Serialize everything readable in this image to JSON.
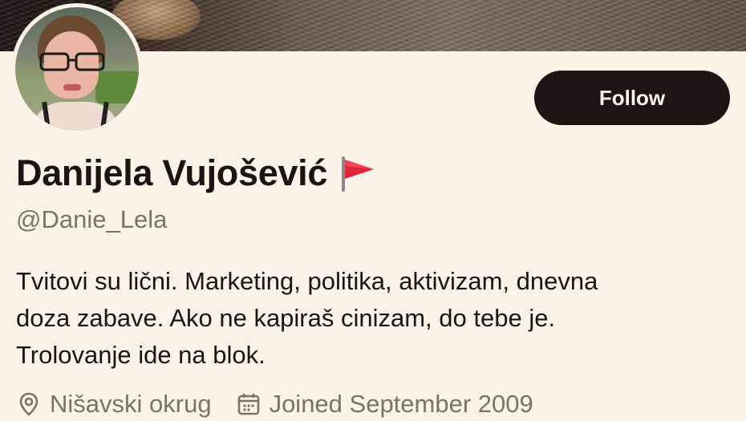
{
  "profile": {
    "display_name": "Danijela Vujošević",
    "name_emoji_icon": "red-flag-icon",
    "handle": "@Danie_Lela",
    "bio_lines": [
      "Tvitovi su lični. Marketing, politika, aktivizam, dnevna",
      "doza zabave. Ako ne kapiraš cinizam, do tebe je.",
      "Trolovanje ide na blok."
    ],
    "location": "Nišavski okrug",
    "joined": "Joined September 2009"
  },
  "actions": {
    "follow_label": "Follow"
  },
  "colors": {
    "background": "#fcf3e8",
    "button_bg": "#1e1412",
    "button_text": "#fcf3e8",
    "secondary_text": "#7d7168",
    "flag": "#e0243a"
  }
}
